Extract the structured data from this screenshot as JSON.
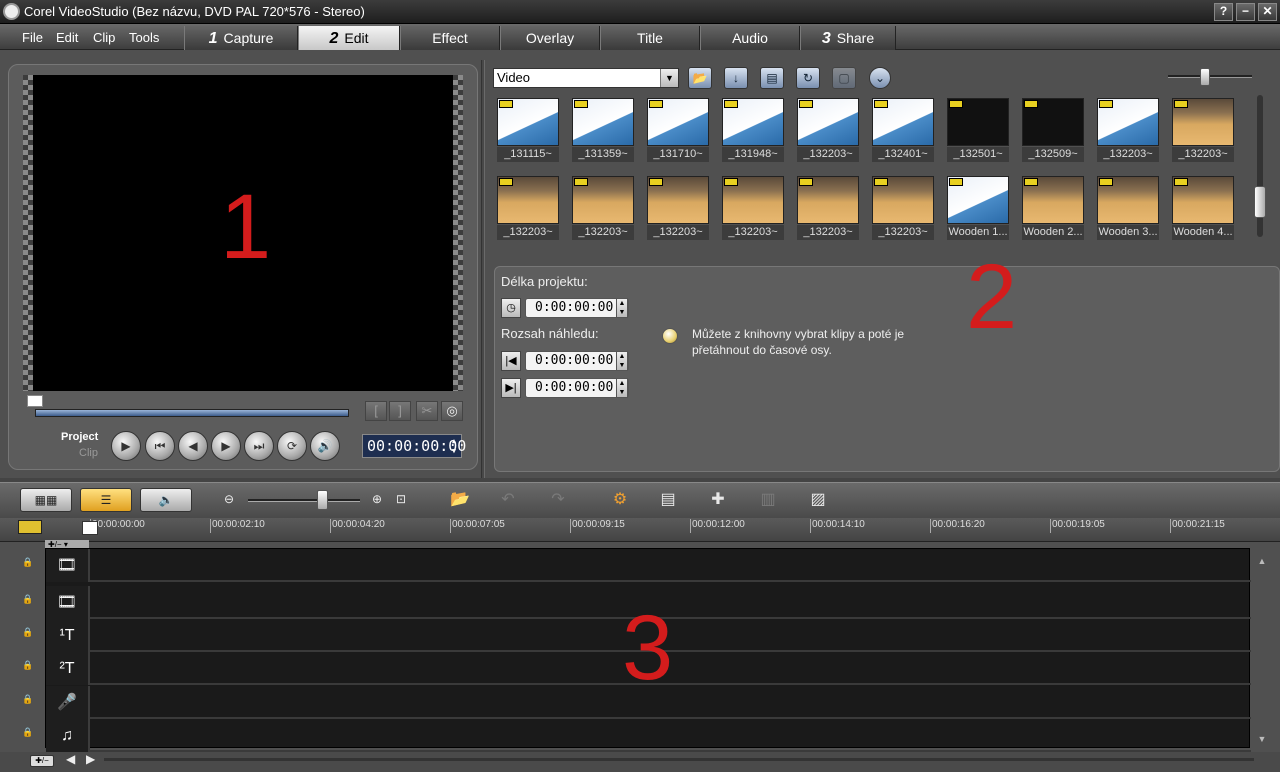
{
  "window": {
    "title": "Corel VideoStudio (Bez názvu, DVD PAL 720*576 - Stereo)",
    "help": "?",
    "minimize": "−",
    "close": "✕"
  },
  "menu": [
    "File",
    "Edit",
    "Clip",
    "Tools"
  ],
  "steps": {
    "capture": {
      "num": "1",
      "label": "Capture"
    },
    "edit": {
      "num": "2",
      "label": "Edit"
    },
    "effect": "Effect",
    "overlay": "Overlay",
    "title": "Title",
    "audio": "Audio",
    "share": {
      "num": "3",
      "label": "Share"
    }
  },
  "overlay_numbers": [
    "1",
    "2",
    "3"
  ],
  "preview": {
    "project_label": "Project",
    "clip_label": "Clip",
    "timecode": "00:00:00:00",
    "mark_in": "[",
    "mark_out": "]",
    "cut": "✂",
    "snapshot": "◎",
    "playback": {
      "play": "▶",
      "start": "⏮",
      "prev": "◀",
      "next": "▶",
      "end": "⏭",
      "repeat": "⟳",
      "volume": "🔊"
    }
  },
  "library": {
    "category": "Video",
    "dropdown_arrow": "▼",
    "icons": {
      "folder": "📂",
      "sort": "↓",
      "list": "▤",
      "refresh": "↻",
      "disabled": "▢",
      "expand": "⌄"
    },
    "clips": [
      {
        "name": "_131115~",
        "kind": "doc"
      },
      {
        "name": "_131359~",
        "kind": "doc"
      },
      {
        "name": "_131710~",
        "kind": "doc"
      },
      {
        "name": "_131948~",
        "kind": "doc"
      },
      {
        "name": "_132203~",
        "kind": "doc"
      },
      {
        "name": "_132401~",
        "kind": "doc"
      },
      {
        "name": "_132501~",
        "kind": "dark"
      },
      {
        "name": "_132509~",
        "kind": "dark"
      },
      {
        "name": "_132203~",
        "kind": "doc"
      },
      {
        "name": "_132203~",
        "kind": "court"
      },
      {
        "name": "_132203~",
        "kind": "court"
      },
      {
        "name": "_132203~",
        "kind": "court"
      },
      {
        "name": "_132203~",
        "kind": "court"
      },
      {
        "name": "_132203~",
        "kind": "court"
      },
      {
        "name": "_132203~",
        "kind": "court"
      },
      {
        "name": "_132203~",
        "kind": "court"
      },
      {
        "name": "Wooden 1...",
        "kind": "doc"
      },
      {
        "name": "Wooden 2...",
        "kind": "court"
      },
      {
        "name": "Wooden 3...",
        "kind": "court"
      },
      {
        "name": "Wooden 4...",
        "kind": "court"
      }
    ]
  },
  "options": {
    "project_length_label": "Délka projektu:",
    "project_length": "0:00:00:00",
    "preview_range_label": "Rozsah náhledu:",
    "range_start": "0:00:00:00",
    "range_end": "0:00:00:00",
    "tip": "Můžete z knihovny vybrat klipy a poté je přetáhnout do časové osy.",
    "icon_clock": "◷",
    "icon_start": "|◀",
    "icon_end": "▶|",
    "spin_up": "▲",
    "spin_down": "▼"
  },
  "timeline": {
    "views": {
      "storyboard": "▦▦",
      "timeline": "☰",
      "audio": "🔈"
    },
    "zoom_out": "⊖",
    "zoom_in": "⊕",
    "fit": "⊡",
    "tools": {
      "import": "📂",
      "undo": "↶",
      "redo": "↷",
      "smart_proxy": "⚙",
      "batch": "▤",
      "add_track": "✚",
      "audio_mix": "▥",
      "chapter": "▨"
    },
    "ruler_ticks": [
      "00:00:00:00",
      "00:00:02:10",
      "00:00:04:20",
      "00:00:07:05",
      "00:00:09:15",
      "00:00:12:00",
      "00:00:14:10",
      "00:00:16:20",
      "00:00:19:05",
      "00:00:21:15"
    ],
    "header_top": "✚/− ▾",
    "tracks": [
      {
        "id": "video",
        "icon": "🎞"
      },
      {
        "id": "overlay",
        "icon": "🎞"
      },
      {
        "id": "title1",
        "icon": "¹T"
      },
      {
        "id": "title2",
        "icon": "²T"
      },
      {
        "id": "voice",
        "icon": "🎤"
      },
      {
        "id": "music",
        "icon": "♫"
      }
    ],
    "lock": "🔒",
    "scroll_up": "▲",
    "scroll_down": "▼",
    "nav_left": "◀",
    "nav_right": "▶",
    "add_btn": "✚/−"
  }
}
